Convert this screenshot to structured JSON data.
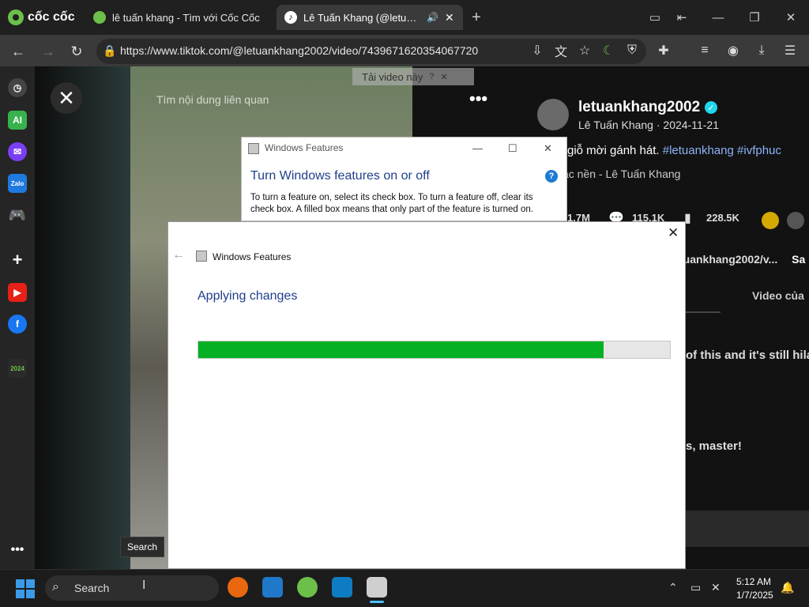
{
  "browser": {
    "brand": "cốc cốc",
    "tabs": [
      {
        "label": "lê tuấn khang - Tìm với Cốc Cốc"
      },
      {
        "label": "Lê Tuấn Khang (@letuank"
      }
    ],
    "url": "https://www.tiktok.com/@letuankhang2002/video/7439671620354067720"
  },
  "page": {
    "download_banner": "Tải video này",
    "related": "Tìm nội dung liên quan",
    "username": "letuankhang2002",
    "subline": "Lê Tuấn Khang · 2024-11-21",
    "caption_text": "giỗ mời gánh hát.",
    "hashtags": [
      "#letuankhang",
      "#ivfphuc"
    ],
    "music": "ạc nền - Lê Tuấn Khang",
    "stats": [
      "1.7M",
      "115.1K",
      "228.5K"
    ],
    "link_partial": "tuankhang2002/v...",
    "link_suffix": "Sa",
    "videos_tab": "Video của",
    "comment1": "of this and it's still hila",
    "comment2": "s, master!"
  },
  "dialog_back": {
    "title": "Windows Features",
    "heading": "Turn Windows features on or off",
    "desc1": "To turn a feature on, select its check box. To turn a feature off, clear its",
    "desc2": "check box. A filled box means that only part of the feature is turned on."
  },
  "dialog": {
    "title": "Windows Features",
    "heading": "Applying changes",
    "progress": 0.86,
    "colors": {
      "progress": "#06b025"
    }
  },
  "taskbar": {
    "search_label": "Search",
    "tooltip": "Search",
    "time": "5:12 AM",
    "date": "1/7/2025"
  }
}
